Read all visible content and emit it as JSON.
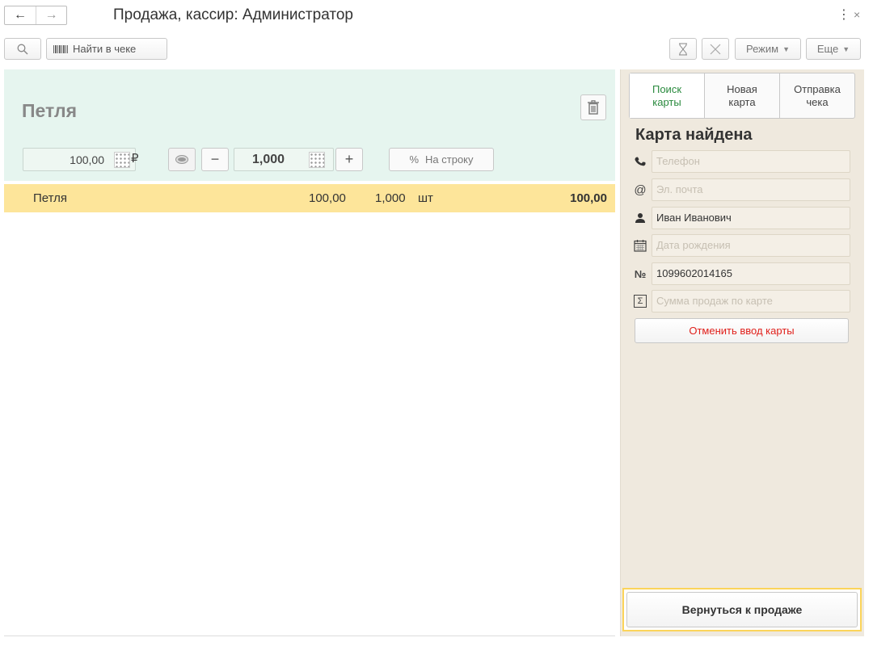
{
  "window": {
    "title": "Продажа, кассир: Администратор",
    "back_icon": "←",
    "forward_icon": "→",
    "more_icon": "⋮",
    "close_icon": "×"
  },
  "toolbar": {
    "find_in_receipt": "Найти в чеке",
    "mode": "Режим",
    "more": "Еще"
  },
  "product": {
    "name": "Петля",
    "price": "100,00",
    "currency": "₽",
    "quantity": "1,000",
    "minus": "−",
    "plus": "+",
    "discount_symbol": "%",
    "discount_label": "На строку"
  },
  "receipt": {
    "rows": [
      {
        "name": "Петля",
        "price": "100,00",
        "quantity": "1,000",
        "unit": "шт",
        "total": "100,00"
      }
    ]
  },
  "side_panel": {
    "tabs": [
      {
        "label": "Поиск\nкарты",
        "active": true
      },
      {
        "label": "Новая\nкарта",
        "active": false
      },
      {
        "label": "Отправка\nчека",
        "active": false
      }
    ],
    "card_status": "Карта найдена",
    "fields": {
      "phone": {
        "placeholder": "Телефон",
        "value": ""
      },
      "email": {
        "placeholder": "Эл. почта",
        "value": ""
      },
      "owner": {
        "placeholder": "",
        "value": "Иван Иванович"
      },
      "birthdate": {
        "placeholder": "Дата рождения",
        "value": ""
      },
      "card_number": {
        "placeholder": "",
        "value": "1099602014165"
      },
      "sales_sum": {
        "placeholder": "Сумма продаж по карте",
        "value": ""
      }
    },
    "icons": {
      "email_symbol": "@",
      "number_symbol": "№",
      "sum_symbol": "Σ"
    },
    "cancel_card": "Отменить ввод карты",
    "return_to_sale": "Вернуться к продаже"
  },
  "colors": {
    "product_panel_bg": "#e6f5ef",
    "selected_row_bg": "#fde59a",
    "side_panel_bg": "#efe9de",
    "active_tab_text": "#2a8a3e",
    "cancel_text": "#e0201b",
    "focus_border": "#fbd45a"
  }
}
